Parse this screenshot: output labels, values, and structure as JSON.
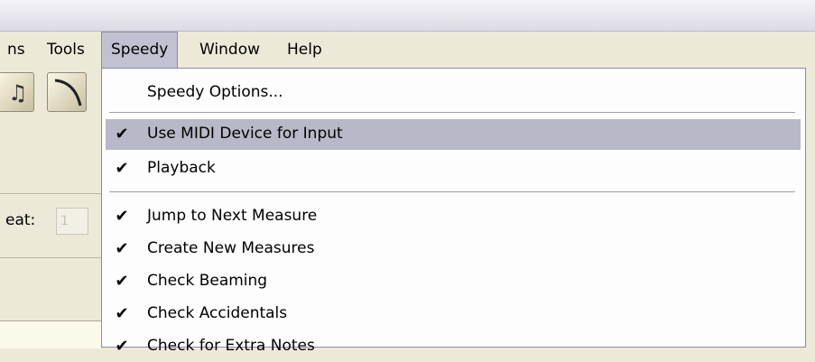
{
  "menubar": {
    "items": [
      {
        "label": "ns"
      },
      {
        "label": "Tools"
      },
      {
        "label": "Speedy"
      },
      {
        "label": "Window"
      },
      {
        "label": "Help"
      }
    ]
  },
  "toolbar": {
    "beat_label": "eat:",
    "beat_value": "1"
  },
  "speedy_menu": {
    "items": [
      {
        "label": "Speedy Options...",
        "checked": false
      },
      {
        "label": "Use MIDI Device for Input",
        "checked": true,
        "highlighted": true
      },
      {
        "label": "Playback",
        "checked": true
      },
      {
        "label": "Jump to Next Measure",
        "checked": true
      },
      {
        "label": "Create New Measures",
        "checked": true
      },
      {
        "label": "Check Beaming",
        "checked": true
      },
      {
        "label": "Check Accidentals",
        "checked": true
      },
      {
        "label": "Check for Extra Notes",
        "checked": true
      }
    ],
    "check_glyph": "✔"
  }
}
